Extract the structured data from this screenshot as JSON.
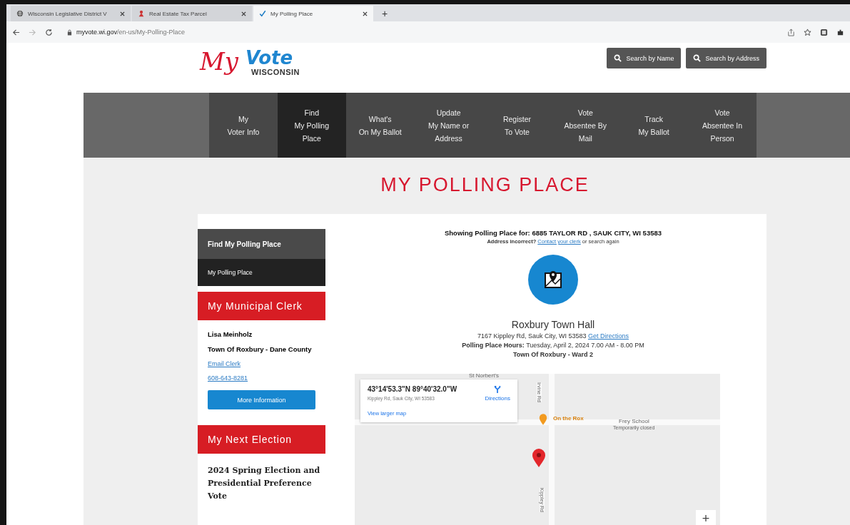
{
  "browser": {
    "tabs": [
      {
        "kind": "site",
        "title": "Wisconsin Legislative District V",
        "selected": false
      },
      {
        "kind": "parcel",
        "title": "Real Estate Tax Parcel",
        "selected": false
      },
      {
        "kind": "vote",
        "title": "My Polling Place",
        "selected": true
      }
    ],
    "new_tab": "+",
    "url_host": "myvote.wi.gov",
    "url_path": "/en-us/My-Polling-Place"
  },
  "logo": {
    "script": "My",
    "word": "Vote",
    "state": "WISCONSIN"
  },
  "search_buttons": [
    "Search by Name",
    "Search by Address"
  ],
  "nav": [
    {
      "label": "My\nVoter Info",
      "selected": false
    },
    {
      "label": "Find\nMy Polling\nPlace",
      "selected": true
    },
    {
      "label": "What's\nOn My Ballot",
      "selected": false
    },
    {
      "label": "Update\nMy Name or\nAddress",
      "selected": false
    },
    {
      "label": "Register\nTo Vote",
      "selected": false
    },
    {
      "label": "Vote\nAbsentee By\nMail",
      "selected": false
    },
    {
      "label": "Track\nMy Ballot",
      "selected": false
    },
    {
      "label": "Vote\nAbsentee In\nPerson",
      "selected": false
    }
  ],
  "page_title": "MY POLLING PLACE",
  "sidebar": {
    "menu_title": "Find My Polling Place",
    "menu_items": [
      {
        "label": "My Polling Place",
        "selected": true
      }
    ],
    "clerk": {
      "title": "My Municipal Clerk",
      "name": "Lisa Meinholz",
      "municipality": "Town Of Roxbury - Dane County",
      "email_link": "Email Clerk",
      "phone_link": "608-643-8281",
      "button": "More Information"
    },
    "election": {
      "title": "My Next Election",
      "name": "2024 Spring Election and Presidential Preference Vote"
    }
  },
  "result": {
    "showing": "Showing Polling Place for: 6885 TAYLOR RD , SAUK CITY, WI 53583",
    "incorrect_prefix": "Address incorrect?",
    "incorrect_link": "Contact your clerk",
    "incorrect_suffix": "or search again",
    "place_name": "Roxbury Town Hall",
    "place_address": "7167 Kippley Rd, Sauk City, WI 53583",
    "directions_link": "Get Directions",
    "hours": "**Polling Place Hours:** Tuesday, April 2, 2024 7.00 AM - 8.00 PM",
    "ward": "Town Of Roxbury - Ward 2"
  },
  "map": {
    "coords": "43°14'53.3\"N 89°40'32.0\"W",
    "address": "Kippley Rd, Sauk City, WI 53583",
    "directions": "Directions",
    "larger_map": "View larger map",
    "labels": [
      {
        "kind": "place",
        "text": "St Norbert's"
      },
      {
        "kind": "poi",
        "text": "On the Rox"
      },
      {
        "kind": "school",
        "text": "Frey School"
      },
      {
        "kind": "note",
        "text": "Temporarily closed"
      },
      {
        "kind": "road",
        "text": "Irvine Rd"
      },
      {
        "kind": "road",
        "text": "Kippley Rd"
      }
    ],
    "zoom": "+"
  }
}
